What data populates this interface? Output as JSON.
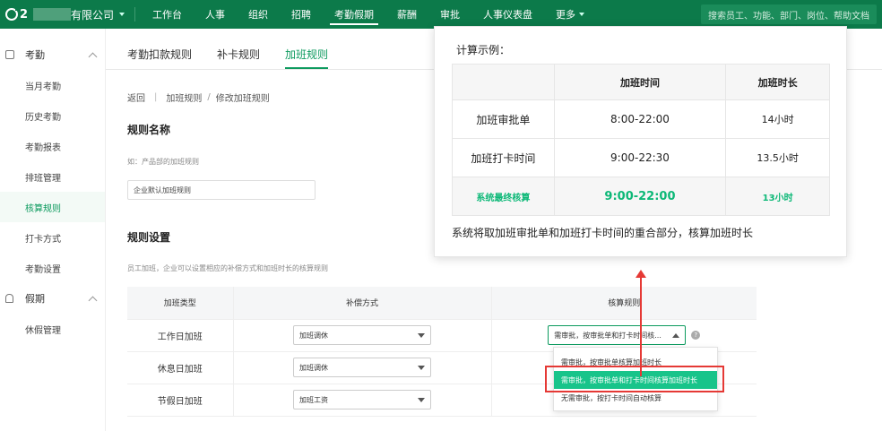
{
  "topnav": {
    "logo_text": "2",
    "company": "有限公司",
    "items": [
      {
        "label": "工作台"
      },
      {
        "label": "人事"
      },
      {
        "label": "组织"
      },
      {
        "label": "招聘"
      },
      {
        "label": "考勤假期"
      },
      {
        "label": "薪酬"
      },
      {
        "label": "审批"
      },
      {
        "label": "人事仪表盘"
      }
    ],
    "more": "更多",
    "search_placeholder": "搜索员工、功能、部门、岗位、帮助文档"
  },
  "sidebar": {
    "group1": "考勤",
    "items1": [
      "当月考勤",
      "历史考勤",
      "考勤报表",
      "排班管理",
      "核算规则",
      "打卡方式",
      "考勤设置"
    ],
    "group2": "假期",
    "items2": [
      "休假管理"
    ]
  },
  "tabs": [
    "考勤扣款规则",
    "补卡规则",
    "加班规则"
  ],
  "breadcrumb": {
    "back": "返回",
    "parent": "加班规则",
    "current": "修改加班规则"
  },
  "rule_name": {
    "title": "规则名称",
    "hint": "如：产品部的加班规则",
    "value": "企业默认加班规则"
  },
  "rule_settings": {
    "title": "规则设置",
    "hint": "员工加班，企业可以设置相应的补偿方式和加班时长的核算规则"
  },
  "rules_table": {
    "headers": [
      "加班类型",
      "补偿方式",
      "核算规则"
    ],
    "rows": [
      {
        "type": "工作日加班",
        "comp": "加班调休",
        "calc": "需审批，按审批单和打卡时间核..."
      },
      {
        "type": "休息日加班",
        "comp": "加班调休"
      },
      {
        "type": "节假日加班",
        "comp": "加班工资"
      }
    ],
    "help": "?"
  },
  "dropdown": {
    "options": [
      "需审批，按审批单核算加班时长",
      "需审批，按审批单和打卡时间核算加班时长",
      "无需审批，按打卡时间自动核算"
    ]
  },
  "popup": {
    "title": "计算示例：",
    "headers": [
      "",
      "加班时间",
      "加班时长"
    ],
    "rows": [
      {
        "label": "加班审批单",
        "time": "8:00-22:00",
        "dur": "14小时"
      },
      {
        "label": "加班打卡时间",
        "time": "9:00-22:30",
        "dur": "13.5小时"
      },
      {
        "label": "系统最终核算",
        "time": "9:00-22:00",
        "dur": "13小时"
      }
    ],
    "desc": "系统将取加班审批单和加班打卡时间的重合部分，核算加班时长"
  },
  "colors": {
    "brand": "#0c7a4a",
    "accent": "#0c9a5e",
    "highlight": "#e53935",
    "selected_option": "#18c48a"
  }
}
